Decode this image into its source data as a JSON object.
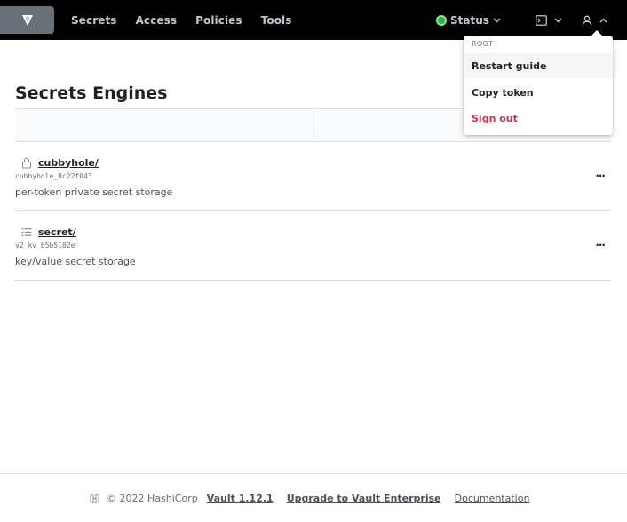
{
  "nav": {
    "links": [
      "Secrets",
      "Access",
      "Policies",
      "Tools"
    ],
    "status_label": "Status",
    "status_color": "#2eb039",
    "logo_icon": "vault-logo-icon",
    "console_icon": "terminal-icon",
    "user_icon": "user-icon"
  },
  "page": {
    "title": "Secrets Engines"
  },
  "engines": [
    {
      "icon": "lock-icon",
      "path": "cubbyhole/",
      "meta": "cubbyhole_8c22f043",
      "description": "per-token private secret storage",
      "menu": "..."
    },
    {
      "icon": "list-icon",
      "path": "secret/",
      "meta": "v2 kv_b5b5102e",
      "description": "key/value secret storage",
      "menu": "..."
    }
  ],
  "user_menu": {
    "header": "ROOT",
    "items": [
      {
        "label": "Restart guide"
      },
      {
        "label": "Copy token"
      },
      {
        "label": "Sign out"
      }
    ]
  },
  "footer": {
    "copyright": "© 2022 HashiCorp",
    "version": "Vault 1.12.1",
    "upgrade": "Upgrade to Vault Enterprise",
    "docs": "Documentation"
  },
  "colors": {
    "accent_danger": "#c73445",
    "navbar": "#000000"
  }
}
